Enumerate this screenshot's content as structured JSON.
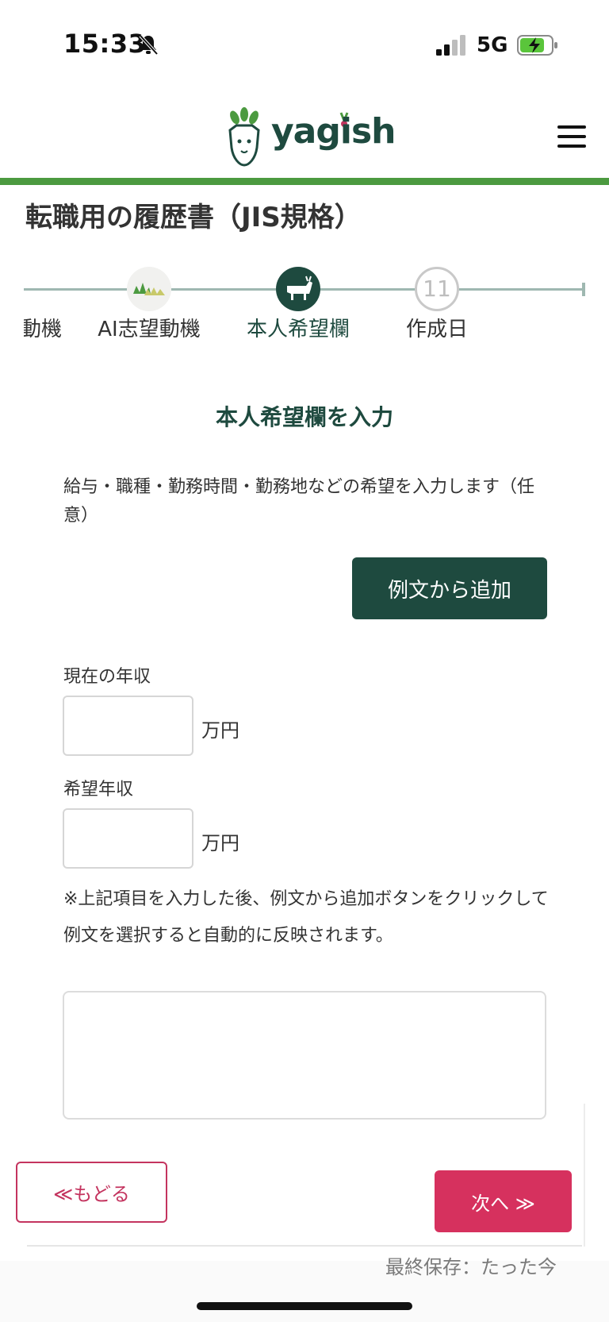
{
  "status_bar": {
    "time": "15:33",
    "network": "5G"
  },
  "header": {
    "brand": "yagish"
  },
  "page": {
    "title": "転職用の履歴書（JIS規格）"
  },
  "stepper": {
    "steps": [
      {
        "label": "動機",
        "state": "done"
      },
      {
        "label": "AI志望動機",
        "state": "done"
      },
      {
        "label": "本人希望欄",
        "state": "active"
      },
      {
        "label": "作成日",
        "state": "future",
        "number": "11"
      }
    ]
  },
  "section": {
    "heading": "本人希望欄を入力",
    "description": "給与・職種・勤務時間・勤務地などの希望を入力します（任意）",
    "sample_button": "例文から追加",
    "current_income_label": "現在の年収",
    "current_income_value": "",
    "desired_income_label": "希望年収",
    "desired_income_value": "",
    "unit": "万円",
    "note": "※上記項目を入力した後、例文から追加ボタンをクリックして例文を選択すると自動的に反映されます。",
    "wish_text": ""
  },
  "nav": {
    "back": "≪もどる",
    "next": "次へ ≫"
  },
  "footer": {
    "last_saved": "最終保存：たった今"
  },
  "colors": {
    "brand_green": "#1e4a3f",
    "accent_green": "#4c9a40",
    "accent_pink": "#d6315e"
  }
}
